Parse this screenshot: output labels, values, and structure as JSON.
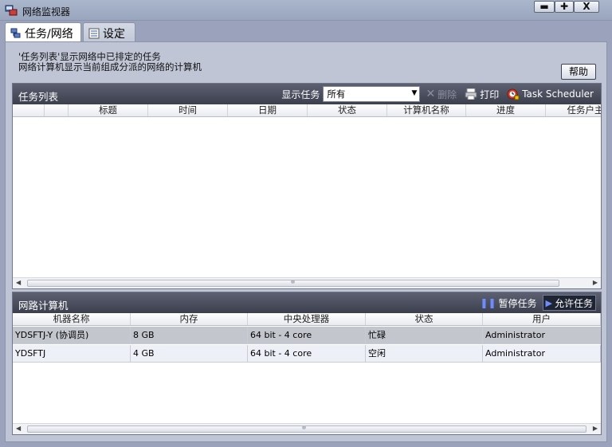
{
  "window": {
    "title": "网络监视器",
    "min_label": "▬",
    "max_label": "✚",
    "close_label": "X"
  },
  "tabs": [
    {
      "label": "任务/网络",
      "icon": "task-network-icon"
    },
    {
      "label": "设定",
      "icon": "settings-list-icon"
    }
  ],
  "description": "'任务列表'显示网络中已排定的任务\n网络计算机显示当前组成分派的网络的计算机",
  "help_label": "帮助",
  "task_panel": {
    "title": "任务列表",
    "filter_label": "显示任务",
    "filter_value": "所有",
    "delete_label": "删除",
    "print_label": "打印",
    "scheduler_label": "Task Scheduler",
    "columns": [
      "",
      "标题",
      "时间",
      "日期",
      "状态",
      "计算机名称",
      "进度",
      "任务户主"
    ]
  },
  "machine_panel": {
    "title": "网路计算机",
    "pause_label": "暂停任务",
    "allow_label": "允许任务",
    "columns": [
      "机器名称",
      "内存",
      "中央处理器",
      "状态",
      "用户"
    ],
    "rows": [
      {
        "name": "YDSFTJ-Y (协调员)",
        "memory": "8 GB",
        "cpu": "64 bit - 4 core",
        "status": "忙碌",
        "user": "Administrator"
      },
      {
        "name": "YDSFTJ",
        "memory": "4 GB",
        "cpu": "64 bit - 4 core",
        "status": "空闲",
        "user": "Administrator"
      }
    ]
  },
  "colors": {
    "header_dark": "#3c3f4d",
    "window_bg": "#9aa3bb",
    "selected_row": "#c3c6cd"
  }
}
